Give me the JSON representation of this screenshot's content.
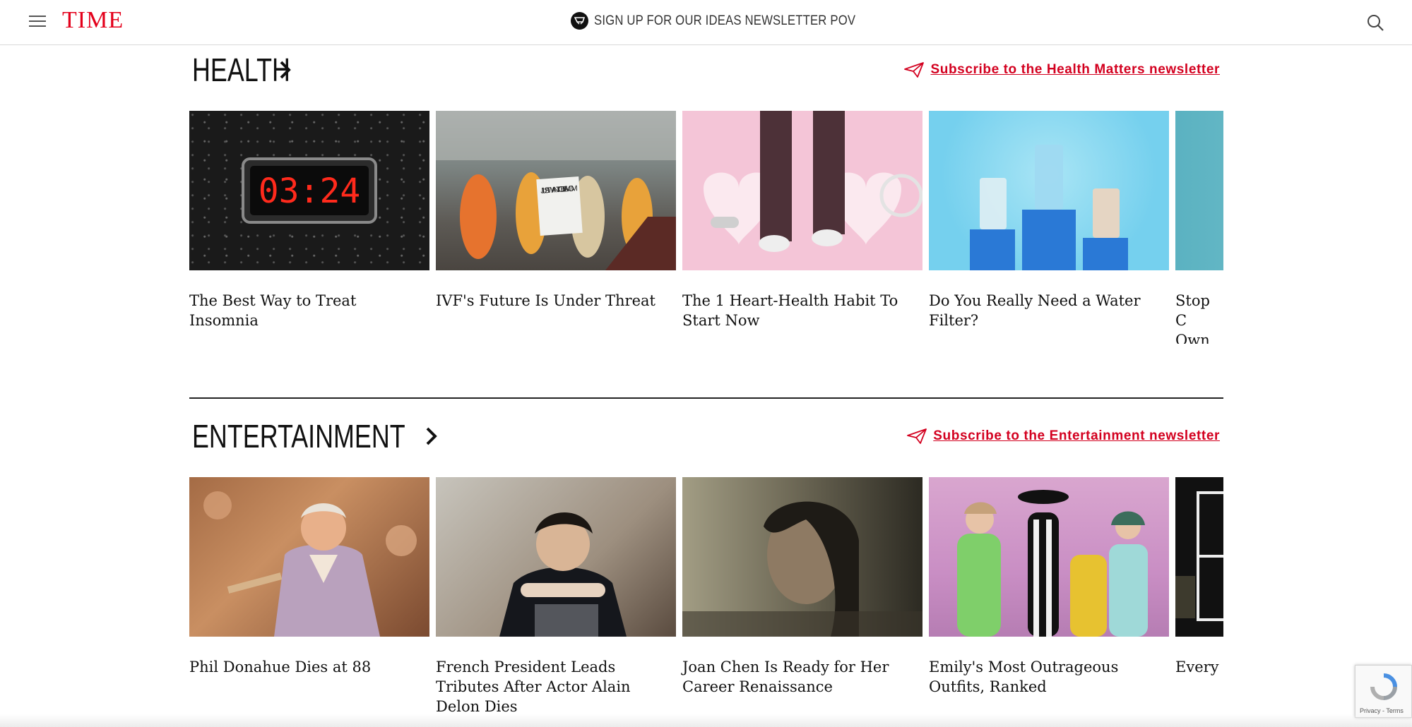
{
  "header": {
    "logo": "TIME",
    "newsletter_promo": "SIGN UP FOR OUR IDEAS NEWSLETTER POV"
  },
  "sections": [
    {
      "title": "HEALTH",
      "subscribe_label": "Subscribe to the Health Matters newsletter",
      "cards": [
        {
          "caption": "The Best Way to Treat Insomnia",
          "image": "digital-clock-03-24-photo",
          "clock_text": "03:24"
        },
        {
          "caption": "IVF's Future Is Under Threat",
          "image": "ivf-protest-photo",
          "sign_text": "I JUST WANT TO BE A MOM"
        },
        {
          "caption": "The 1 Heart-Health Habit To Start Now",
          "image": "walking-legs-hearts-photo"
        },
        {
          "caption": "Do You Really Need a Water Filter?",
          "image": "water-glasses-podium-photo"
        },
        {
          "caption": "Stop C Own H",
          "image": "teal-cropped-photo"
        }
      ]
    },
    {
      "title": "ENTERTAINMENT",
      "subscribe_label": "Subscribe to the Entertainment newsletter",
      "cards": [
        {
          "caption": "Phil Donahue Dies at 88",
          "image": "phil-donahue-photo"
        },
        {
          "caption": "French President Leads Tributes After Actor Alain Delon Dies",
          "image": "alain-delon-photo"
        },
        {
          "caption": "Joan Chen Is Ready for Her Career Renaissance",
          "image": "joan-chen-photo"
        },
        {
          "caption": "Emily's Most Outrageous Outfits, Ranked",
          "image": "emily-outfits-photo"
        },
        {
          "caption": "Every",
          "image": "dark-cropped-photo"
        }
      ]
    }
  ],
  "recaptcha": {
    "footer": "Privacy - Terms"
  },
  "colors": {
    "brand_red": "#e4001b",
    "link_red": "#d3001f"
  }
}
